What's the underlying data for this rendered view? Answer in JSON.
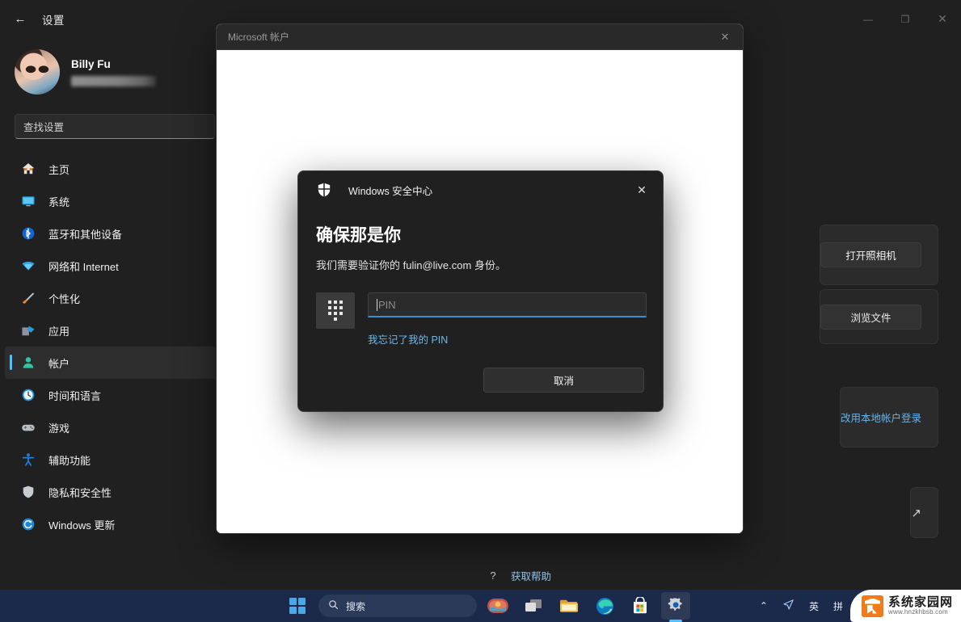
{
  "settings_window": {
    "title": "设置",
    "back_icon": "←",
    "controls": {
      "minimize": "—",
      "maximize": "❐",
      "close": "✕"
    }
  },
  "profile": {
    "name": "Billy Fu",
    "email_masked": ""
  },
  "search": {
    "placeholder": "查找设置",
    "value": "查找设置"
  },
  "sidebar": {
    "items": [
      {
        "label": "主页",
        "icon": "home-icon",
        "glyph": "🏠",
        "active": false
      },
      {
        "label": "系统",
        "icon": "display-icon",
        "glyph": "🖥",
        "active": false
      },
      {
        "label": "蓝牙和其他设备",
        "icon": "bluetooth-icon",
        "glyph": "🔵",
        "active": false
      },
      {
        "label": "网络和 Internet",
        "icon": "wifi-icon",
        "glyph": "📶",
        "active": false
      },
      {
        "label": "个性化",
        "icon": "brush-icon",
        "glyph": "🖌",
        "active": false
      },
      {
        "label": "应用",
        "icon": "apps-icon",
        "glyph": "🗂",
        "active": false
      },
      {
        "label": "帐户",
        "icon": "account-icon",
        "glyph": "👤",
        "active": true
      },
      {
        "label": "时间和语言",
        "icon": "clock-icon",
        "glyph": "🕐",
        "active": false
      },
      {
        "label": "游戏",
        "icon": "gamepad-icon",
        "glyph": "🎮",
        "active": false
      },
      {
        "label": "辅助功能",
        "icon": "accessibility-icon",
        "glyph": "🧍",
        "active": false
      },
      {
        "label": "隐私和安全性",
        "icon": "shield-icon",
        "glyph": "🛡",
        "active": false
      },
      {
        "label": "Windows 更新",
        "icon": "update-icon",
        "glyph": "🔄",
        "active": false
      }
    ]
  },
  "content": {
    "open_camera_button": "打开照相机",
    "browse_files_button": "浏览文件",
    "local_account_link": "改用本地帐户登录",
    "external_link_icon": "↗",
    "get_help": {
      "label": "获取帮助",
      "icon": "help-icon",
      "glyph": "?"
    }
  },
  "ms_account_window": {
    "title": "Microsoft 帐户",
    "close_icon": "✕"
  },
  "security_dialog": {
    "app_name": "Windows 安全中心",
    "close_icon": "✕",
    "heading": "确保那是你",
    "subtitle": "我们需要验证你的 fulin@live.com 身份。",
    "pin_placeholder": "PIN",
    "pin_value": "",
    "forgot_pin_link": "我忘记了我的 PIN",
    "cancel_button": "取消",
    "accent_color": "#3a8fd0",
    "link_color": "#70b8e8"
  },
  "taskbar": {
    "start_label": "start-button",
    "search_placeholder": "搜索",
    "search_icon": "search-icon",
    "items": [
      {
        "name": "widgets-icon",
        "glyph": "🌙"
      },
      {
        "name": "task-view-icon",
        "glyph": "❐"
      },
      {
        "name": "file-explorer-icon",
        "glyph": "📁"
      },
      {
        "name": "edge-icon",
        "glyph": "🌐"
      },
      {
        "name": "microsoft-store-icon",
        "glyph": "🛍"
      },
      {
        "name": "settings-icon",
        "glyph": "⚙"
      }
    ],
    "tray": {
      "chevron": "⌃",
      "network_icon": "◁",
      "ime_mode": "英",
      "ime_pinyin": "拼"
    },
    "watermark": {
      "name": "系统家园网",
      "url": "www.hnzkhbsb.com"
    }
  }
}
